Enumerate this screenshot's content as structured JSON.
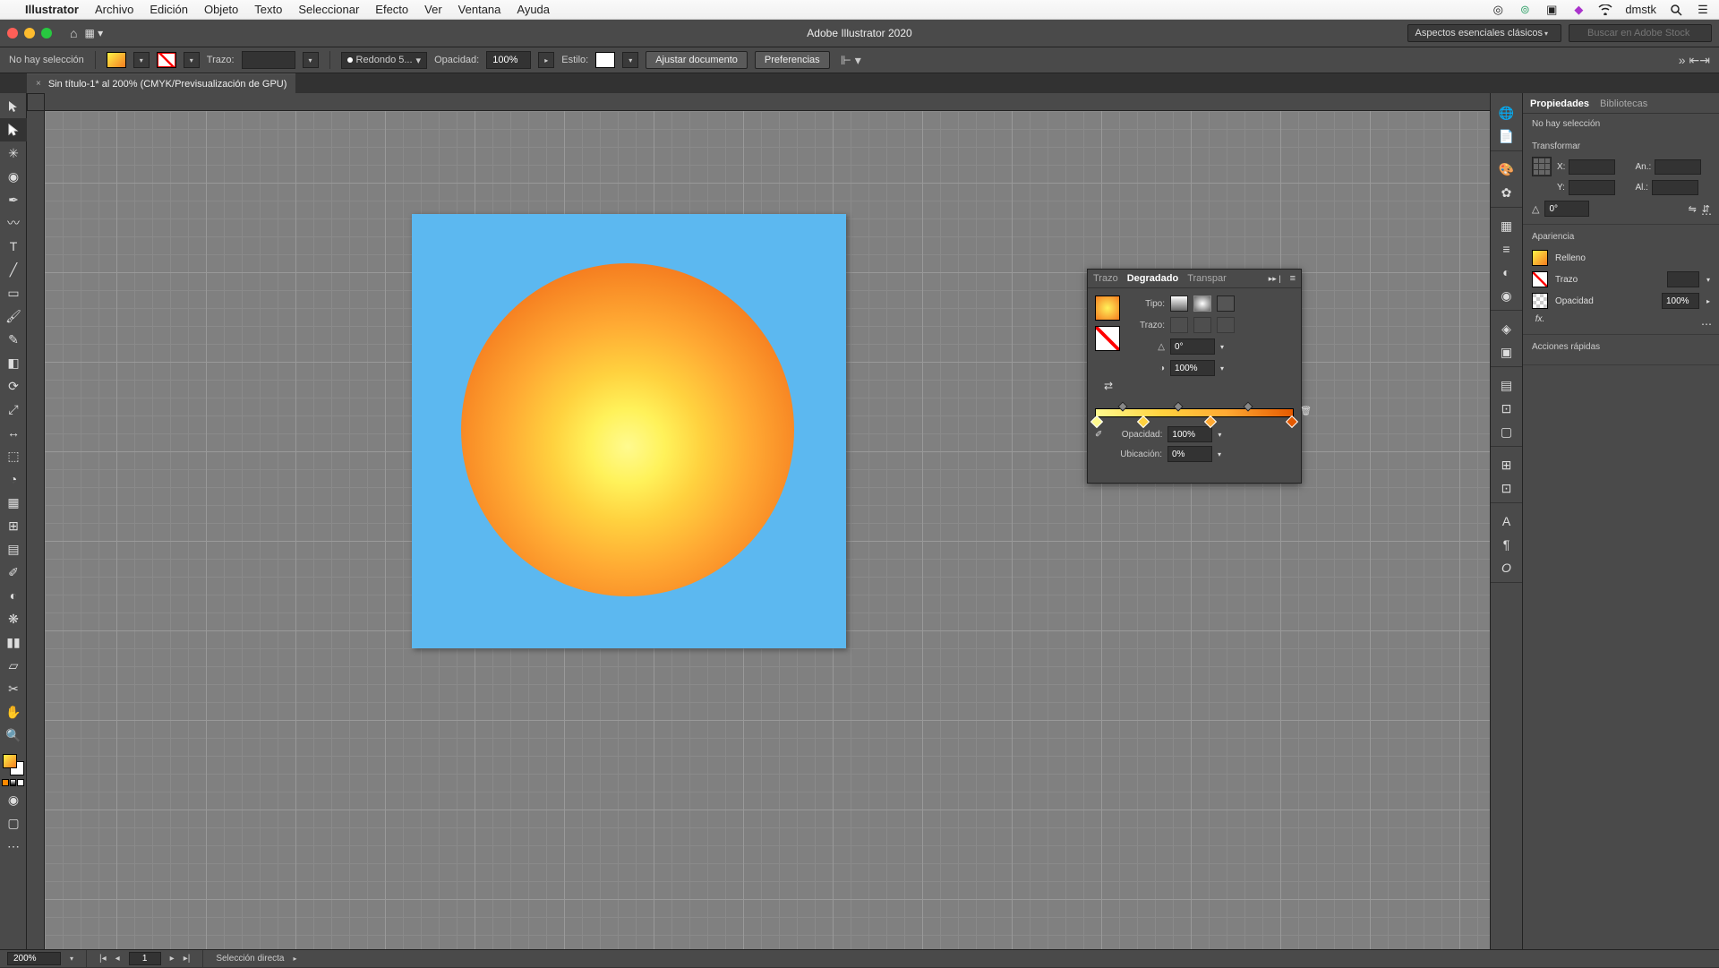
{
  "mac_menu": {
    "app": "Illustrator",
    "items": [
      "Archivo",
      "Edición",
      "Objeto",
      "Texto",
      "Seleccionar",
      "Efecto",
      "Ver",
      "Ventana",
      "Ayuda"
    ],
    "right_user": "dmstk"
  },
  "app_title": "Adobe Illustrator 2020",
  "workspace": "Aspectos esenciales clásicos",
  "search_placeholder": "Buscar en Adobe Stock",
  "control_bar": {
    "selection_label": "No hay selección",
    "stroke_label": "Trazo:",
    "dash_label": "Redondo 5...",
    "opacity_label": "Opacidad:",
    "opacity_value": "100%",
    "style_label": "Estilo:",
    "adjust_doc": "Ajustar documento",
    "prefs": "Preferencias"
  },
  "doc_tab": "Sin título-1* al 200% (CMYK/Previsualización de GPU)",
  "gradient_panel": {
    "tabs": [
      "Trazo",
      "Degradado",
      "Transpar"
    ],
    "active_tab": 1,
    "type_label": "Tipo:",
    "stroke_label": "Trazo:",
    "angle_value": "0°",
    "aspect_value": "100%",
    "opacity_label": "Opacidad:",
    "opacity_value": "100%",
    "location_label": "Ubicación:",
    "location_value": "0%"
  },
  "props": {
    "tabs": [
      "Propiedades",
      "Bibliotecas"
    ],
    "selection": "No hay selección",
    "transform_title": "Transformar",
    "x_label": "X:",
    "y_label": "Y:",
    "w_label": "An.:",
    "h_label": "Al.:",
    "x_val": "",
    "y_val": "",
    "w_val": "",
    "h_val": "",
    "angle_val": "0°",
    "appearance_title": "Apariencia",
    "fill_label": "Relleno",
    "stroke_label": "Trazo",
    "opacity_label": "Opacidad",
    "opacity_value": "100%",
    "fx_label": "fx.",
    "quick_actions_title": "Acciones rápidas"
  },
  "status": {
    "zoom": "200%",
    "page_nav": "1",
    "tool_hint": "Selección directa"
  },
  "colors": {
    "artboard_bg": "#5cb8f0"
  },
  "gradient_stops": [
    {
      "pos": 0,
      "color": "#fffa8f"
    },
    {
      "pos": 22,
      "color": "#ffd23f"
    },
    {
      "pos": 56,
      "color": "#ffa933"
    },
    {
      "pos": 100,
      "color": "#e55a00"
    }
  ],
  "dock_icons": [
    "globe",
    "page",
    "palette",
    "flower",
    "swatch-grid",
    "stroke",
    "dots",
    "circle",
    "grid",
    "align",
    "typography",
    "text",
    "anchor"
  ]
}
